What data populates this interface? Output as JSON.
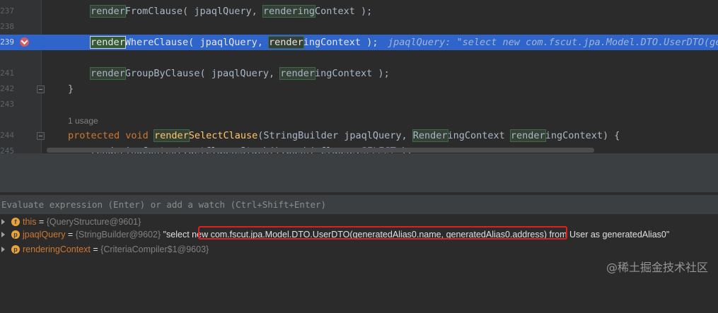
{
  "editor": {
    "line_numbers": [
      "237",
      "238",
      "239",
      "241",
      "242",
      "243",
      "244",
      "245"
    ],
    "lines": {
      "l237": {
        "a": "render",
        "b": "FromClause( ",
        "c": "jpaqlQuery, ",
        "d": "rendering",
        "e": "Context );"
      },
      "l239": {
        "a": "render",
        "b": "WhereClause( ",
        "c": "jpaqlQuery, ",
        "d": "render",
        "e": "ingContext );"
      },
      "l239_inline": "jpaqlQuery: \"select new com.fscut.jpa.Model.DTO.UserDTO(gen",
      "l241": {
        "a": "render",
        "b": "GroupByClause( ",
        "c": "jpaqlQuery, ",
        "d": "render",
        "e": "ingContext );"
      },
      "l242": "}",
      "usage": "1 usage",
      "l244": {
        "kw1": "protected",
        "kw2": "void",
        "fn_hl": "render",
        "fn": "SelectClause",
        "p1": "(StringBuilder jpaqlQuery, ",
        "p2_hl": "Render",
        "p2": "ingContext ",
        "p3_hl": "render",
        "p3": "ingContext) {"
      },
      "l245": {
        "a": "renderingContext.getClauseStack().push( Clause.",
        "b": "SELECT",
        "c": " );"
      }
    }
  },
  "debugger": {
    "eval_placeholder": "Evaluate expression (Enter) or add a watch (Ctrl+Shift+Enter)",
    "variables": [
      {
        "icon": "field-icon",
        "name": "this",
        "eq": " = ",
        "type": "{QueryStructure@9601}",
        "value": ""
      },
      {
        "icon": "parameter-icon",
        "name": "jpaqlQuery",
        "eq": " = ",
        "type": "{StringBuilder@9602}",
        "value": " \"select new com.fscut.jpa.Model.DTO.UserDTO(generatedAlias0.name, generatedAlias0.address) from User as generatedAlias0\""
      },
      {
        "icon": "parameter-icon",
        "name": "renderingContext",
        "eq": " = ",
        "type": "{CriteriaCompiler$1@9603}",
        "value": ""
      }
    ]
  },
  "watermark": "@稀土掘金技术社区",
  "colors": {
    "breakpoint": "#db5860",
    "current_line": "#2f65ca",
    "highlight_box": "#e02020",
    "param_icon": "#e8a33d",
    "field_icon": "#e8a33d"
  }
}
